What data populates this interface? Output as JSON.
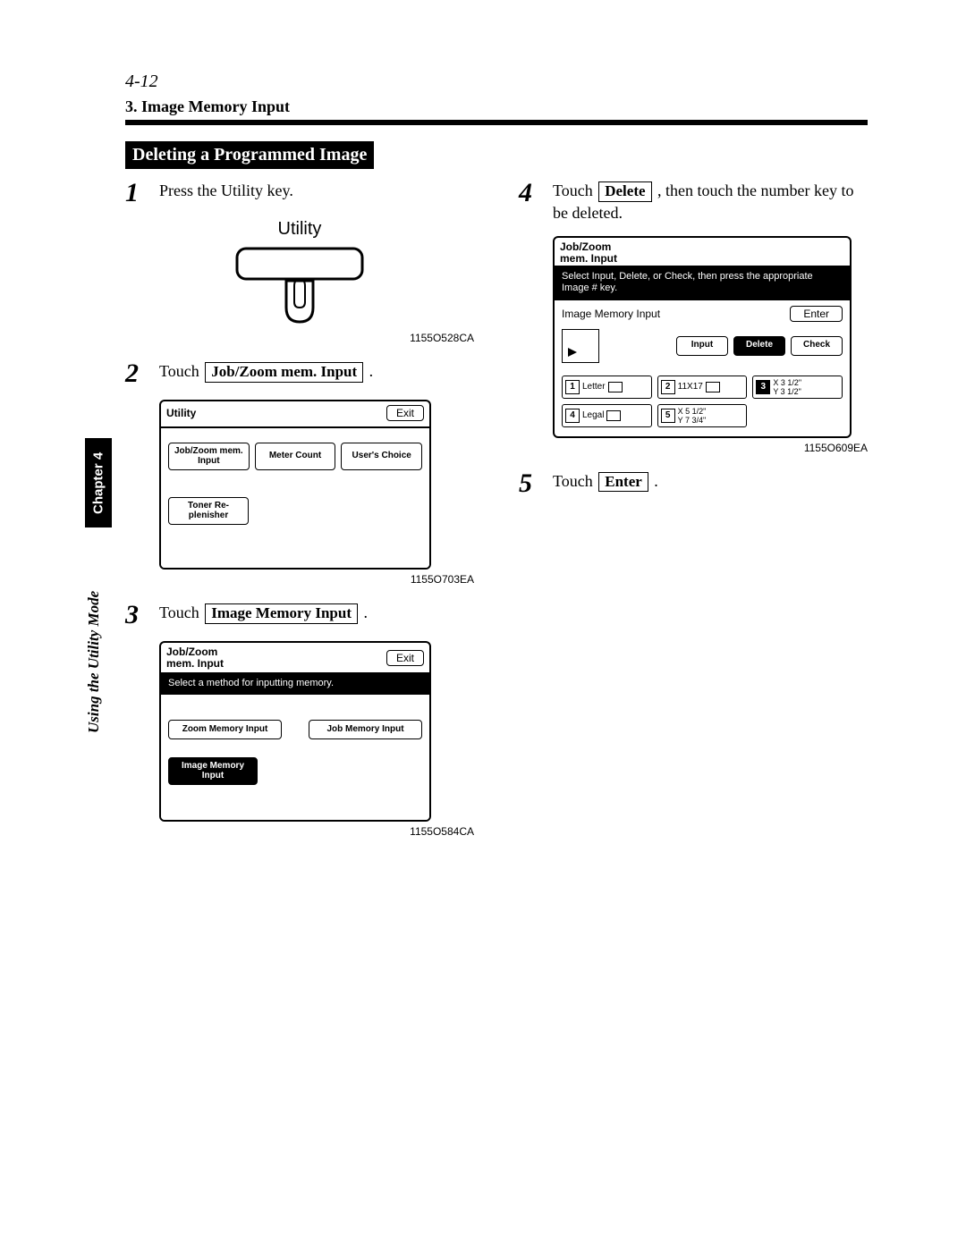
{
  "header": {
    "page_num": "4-12",
    "subsection": "3. Image Memory Input"
  },
  "title": "Deleting a Programmed Image",
  "side": {
    "chapter_tab": "Chapter 4",
    "running_text": "Using the Utility Mode"
  },
  "steps": {
    "s1": {
      "num": "1",
      "text": "Press the Utility key.",
      "key_label": "Utility",
      "caption": "1155O528CA"
    },
    "s2": {
      "num": "2",
      "text_before": "Touch ",
      "button": "Job/Zoom mem. Input",
      "text_after": " .",
      "screen": {
        "title": "Utility",
        "exit": "Exit",
        "btn_jobzoom": "Job/Zoom\nmem. Input",
        "btn_meter": "Meter\nCount",
        "btn_user": "User's\nChoice",
        "btn_toner": "Toner Re-\nplenisher"
      },
      "caption": "1155O703EA"
    },
    "s3": {
      "num": "3",
      "text_before": "Touch ",
      "button": "Image Memory Input",
      "text_after": " .",
      "screen": {
        "title": "Job/Zoom\nmem. Input",
        "exit": "Exit",
        "msg": "Select a method for inputting memory.",
        "btn_zoom": "Zoom Memory\nInput",
        "btn_job": "Job Memory\nInput",
        "btn_image": "Image\nMemory Input"
      },
      "caption": "1155O584CA"
    },
    "s4": {
      "num": "4",
      "text_before": "Touch ",
      "button": "Delete",
      "text_after": " , then touch the number key to be deleted.",
      "screen": {
        "title": "Job/Zoom\nmem. Input",
        "msg": "Select Input, Delete, or Check, then press the appropriate Image # key.",
        "label": "Image Memory Input",
        "enter": "Enter",
        "mode_input": "Input",
        "mode_delete": "Delete",
        "mode_check": "Check",
        "slot1_num": "1",
        "slot1_label": "Letter",
        "slot2_num": "2",
        "slot2_label": "11X17",
        "slot3_num": "3",
        "slot3_label": "X 3 1/2\"\nY 3 1/2\"",
        "slot4_num": "4",
        "slot4_label": "Legal",
        "slot5_num": "5",
        "slot5_label": "X 5 1/2\"\nY 7 3/4\""
      },
      "caption": "1155O609EA"
    },
    "s5": {
      "num": "5",
      "text_before": "Touch ",
      "button": "Enter",
      "text_after": " ."
    }
  }
}
